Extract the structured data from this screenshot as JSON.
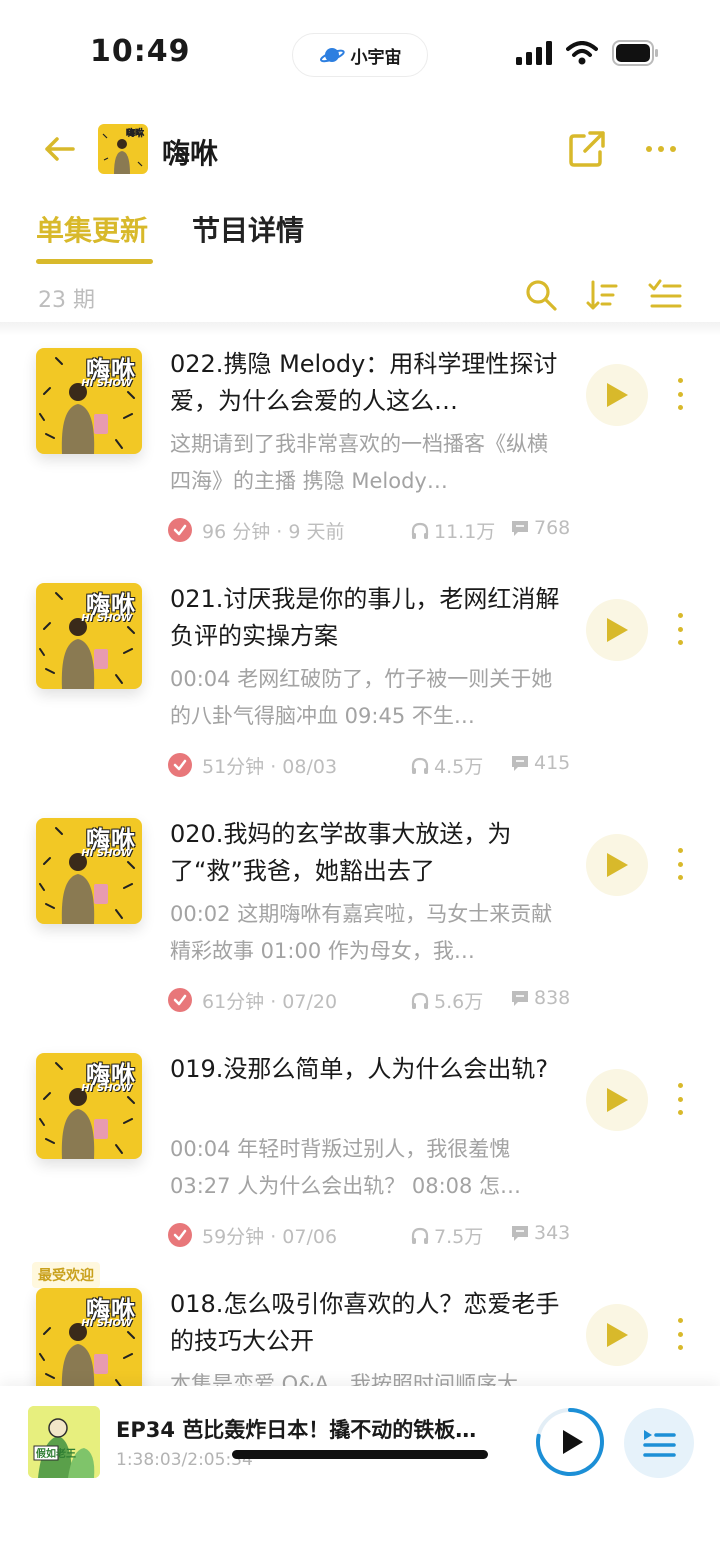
{
  "status_bar": {
    "time": "10:49",
    "pill_label": "小宇宙"
  },
  "header": {
    "title": "嗨咻"
  },
  "tabs": [
    {
      "label": "单集更新"
    },
    {
      "label": "节目详情"
    }
  ],
  "episode_count": "23 期",
  "cover_text": {
    "title": "嗨咻",
    "subtitle": "HI SHOW"
  },
  "episodes": [
    {
      "title": "022.携隐 Melody：用科学理性探讨爱，为什么会爱的人这么…",
      "desc": "这期请到了我非常喜欢的一档播客《纵横四海》的主播 携隐 Melody…",
      "duration": "96 分钟 · 9 天前",
      "plays": "11.1万",
      "comments": "768"
    },
    {
      "title": "021.讨厌我是你的事儿，老网红消解负评的实操方案",
      "desc": "00:04 老网红破防了，竹子被一则关于她的八卦气得脑冲血 09:45 不生…",
      "duration": "51分钟 · 08/03",
      "plays": "4.5万",
      "comments": "415"
    },
    {
      "title": "020.我妈的玄学故事大放送，为了“救”我爸，她豁出去了",
      "desc": "00:02 这期嗨咻有嘉宾啦，马女士来贡献精彩故事 01:00 作为母女，我…",
      "duration": "61分钟 · 07/20",
      "plays": "5.6万",
      "comments": "838"
    },
    {
      "title": "019.没那么简单，人为什么会出轨?",
      "desc": "00:04 年轻时背叛过别人，我很羞愧 03:27 人为什么会出轨？ 08:08 怎…",
      "duration": "59分钟 · 07/06",
      "plays": "7.5万",
      "comments": "343"
    },
    {
      "title": "018.怎么吸引你喜欢的人？恋爱老手的技巧大公开",
      "desc": "本集是恋爱 Q&A，我按照时间顺序大…",
      "badge": "最受欢迎"
    }
  ],
  "mini_player": {
    "title": "EP34 芭比轰炸日本！撬不动的铁板…",
    "time": "1:38:03/2:05:34",
    "cover_text": "假如老王"
  },
  "colors": {
    "accent": "#d8b92b",
    "cover_yellow": "#f2c825",
    "check_red": "#e8777a",
    "player_blue": "#1c8fd6"
  }
}
